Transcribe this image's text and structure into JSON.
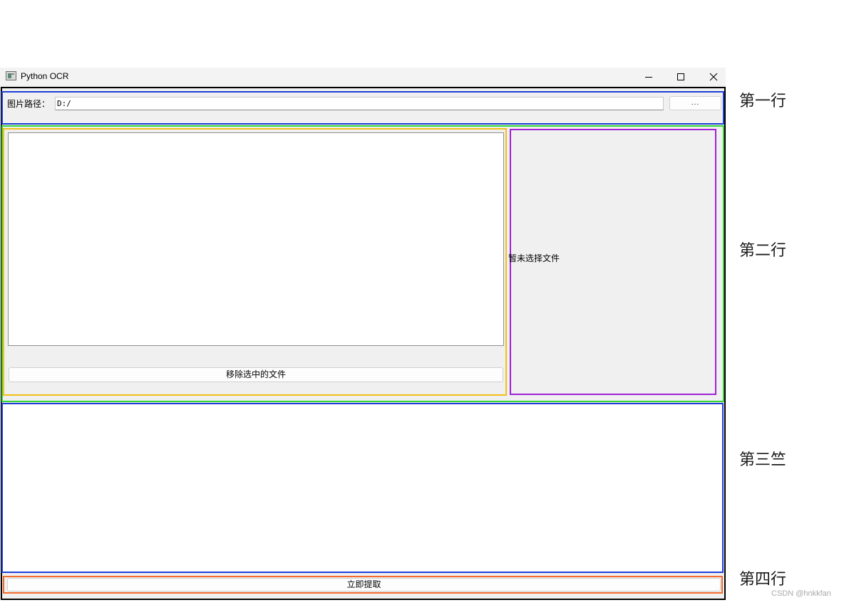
{
  "window": {
    "title": "Python OCR"
  },
  "row1": {
    "path_label": "图片路径：",
    "path_value": "D:/",
    "browse_label": "..."
  },
  "row2": {
    "remove_button": "移除选中的文件",
    "preview_text": "暂未选择文件"
  },
  "row4": {
    "extract_button": "立即提取"
  },
  "annotations": {
    "row1": "第一行",
    "row2": "第二行",
    "row3": "第三竺",
    "row4": "第四行"
  },
  "colors": {
    "row1_border": "#1f3fd8",
    "row2_border": "#35d435",
    "left_group_border": "#f1bf18",
    "preview_border": "#a020d8",
    "row3_border": "#1f3fd8",
    "row4_border": "#f26a2e"
  },
  "watermark": "CSDN @hnkkfan"
}
